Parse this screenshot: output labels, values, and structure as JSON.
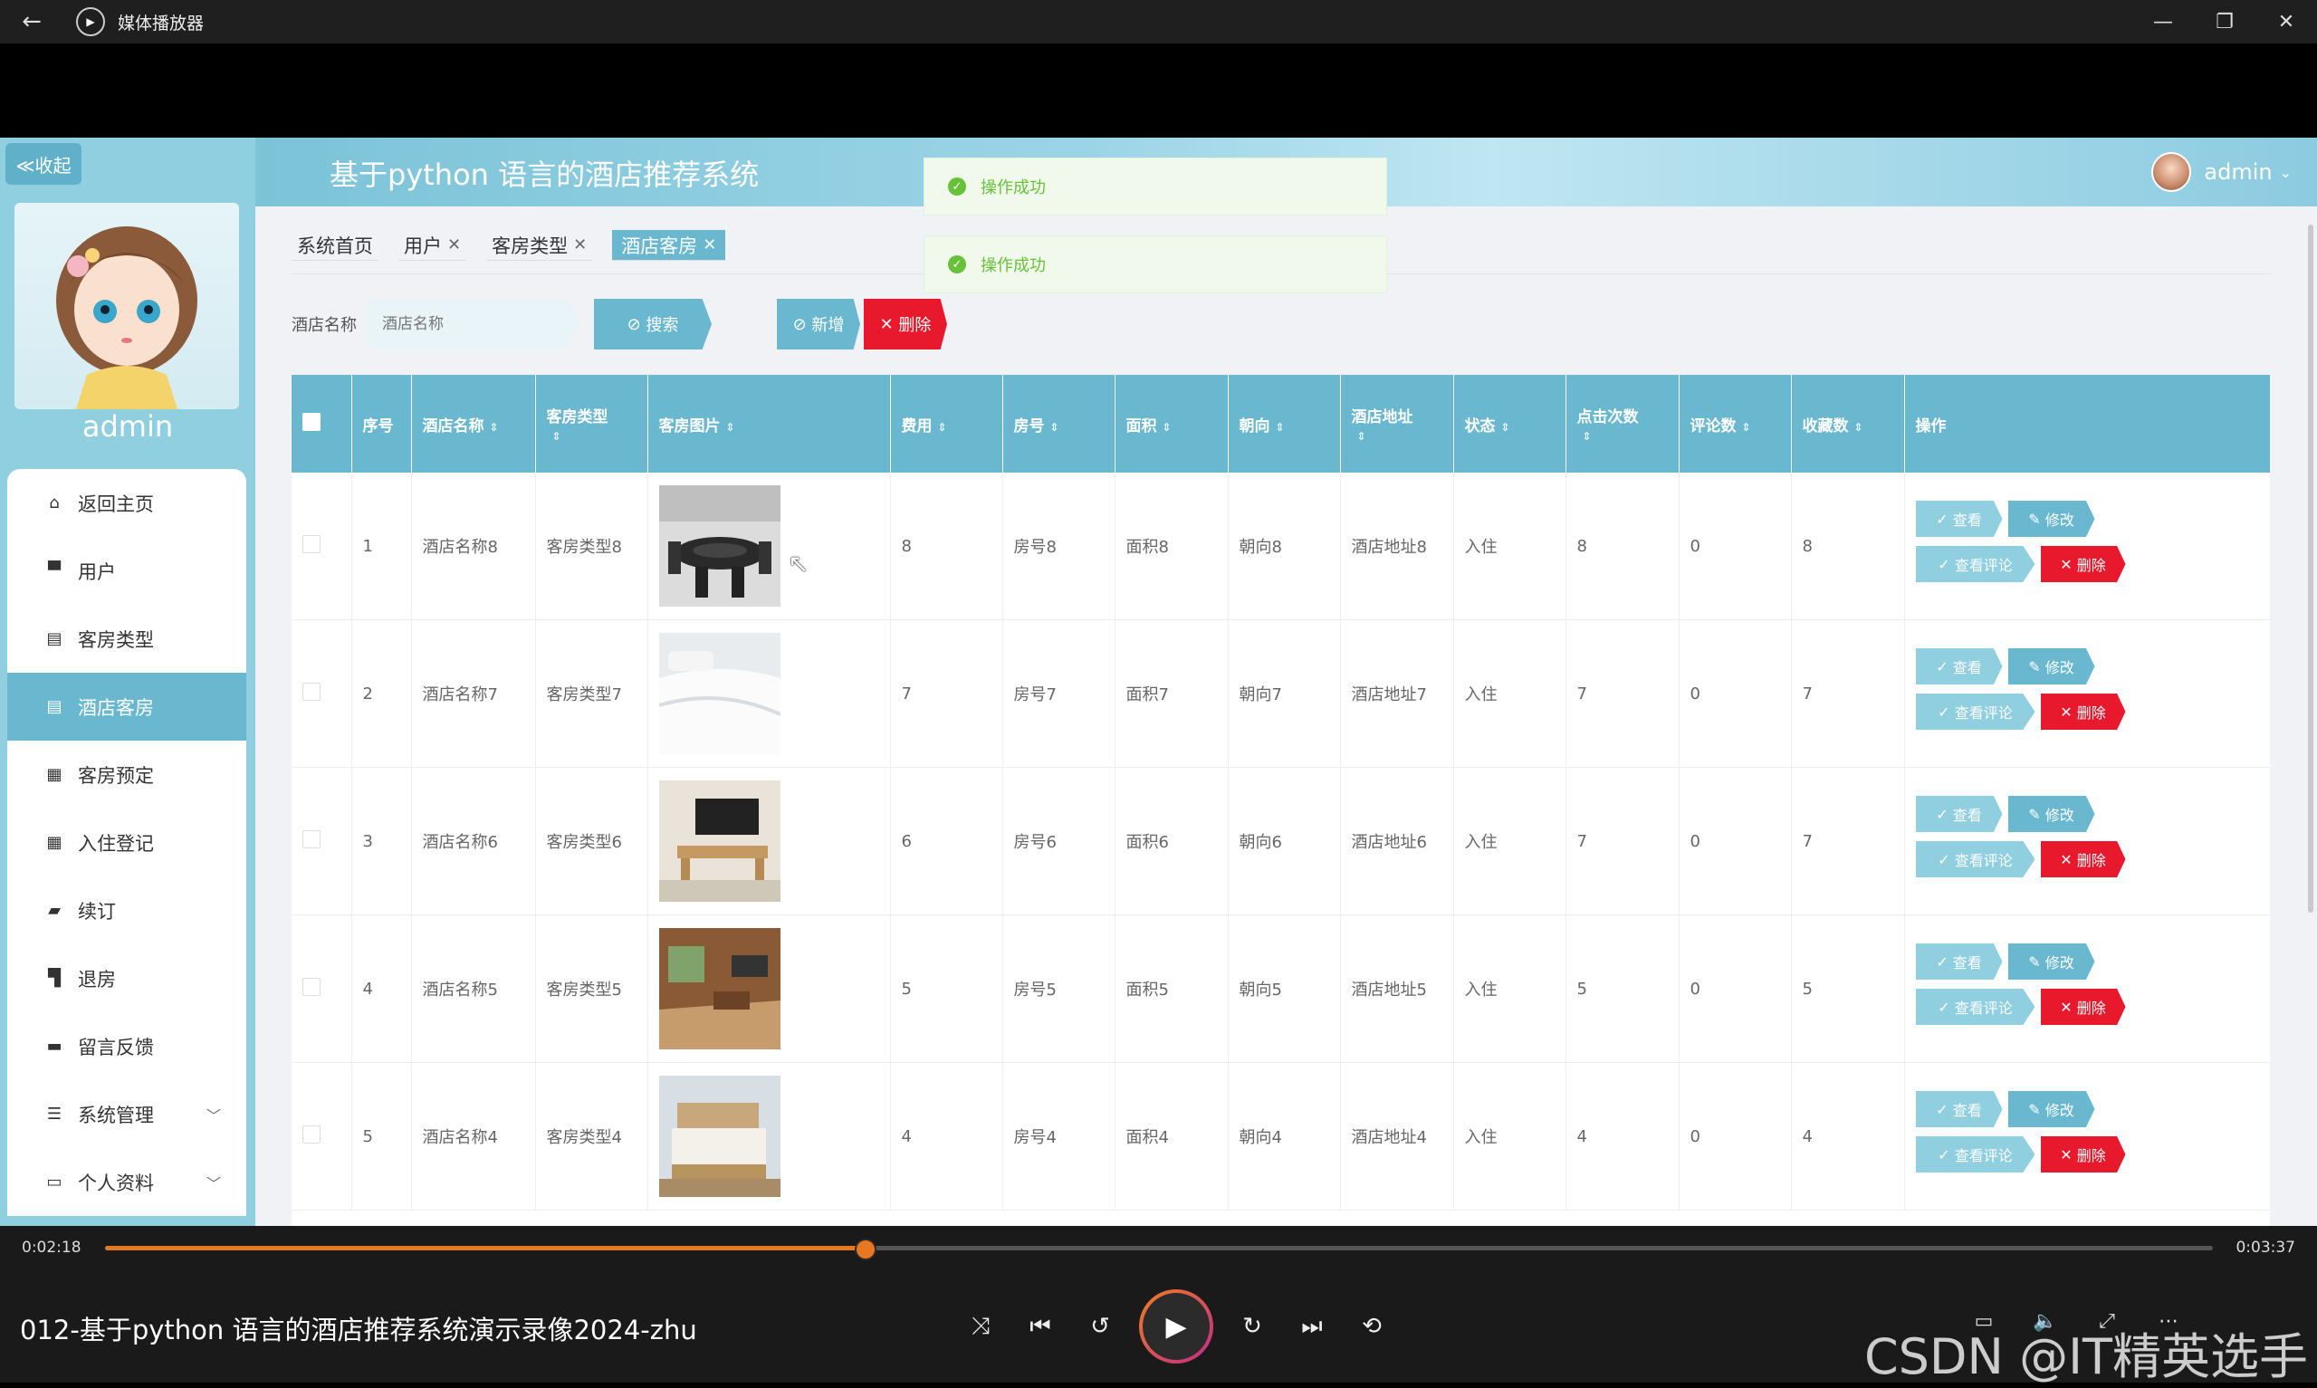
{
  "player": {
    "window_title": "媒体播放器",
    "current_time": "0:02:18",
    "total_time": "0:03:37",
    "progress_fraction": 0.36,
    "media_title": "012-基于python 语言的酒店推荐系统演示录像2024-zhu",
    "watermark": "CSDN @IT精英选手"
  },
  "app": {
    "title": "基于python 语言的酒店推荐系统",
    "collapse_label": "≪收起",
    "user_name": "admin",
    "sidebar_username": "admin",
    "menu": [
      {
        "label": "返回主页",
        "icon": "home-icon"
      },
      {
        "label": "用户",
        "icon": "user-icon"
      },
      {
        "label": "客房类型",
        "icon": "list-icon"
      },
      {
        "label": "酒店客房",
        "icon": "list-icon",
        "active": true
      },
      {
        "label": "客房预定",
        "icon": "grid-icon"
      },
      {
        "label": "入住登记",
        "icon": "grid-icon"
      },
      {
        "label": "续订",
        "icon": "renew-icon"
      },
      {
        "label": "退房",
        "icon": "checkout-icon"
      },
      {
        "label": "留言反馈",
        "icon": "message-icon"
      },
      {
        "label": "系统管理",
        "icon": "settings-icon",
        "expandable": true
      },
      {
        "label": "个人资料",
        "icon": "profile-icon",
        "expandable": true
      }
    ],
    "tabs": [
      {
        "label": "系统首页",
        "closable": false
      },
      {
        "label": "用户",
        "closable": true
      },
      {
        "label": "客房类型",
        "closable": true
      },
      {
        "label": "酒店客房",
        "closable": true,
        "active": true
      }
    ],
    "search": {
      "label": "酒店名称",
      "placeholder": "酒店名称",
      "search_button": "搜索",
      "add_button": "新增",
      "delete_button": "删除"
    },
    "toasts": [
      "操作成功",
      "操作成功"
    ],
    "table": {
      "headers": [
        "序号",
        "酒店名称",
        "客房类型",
        "客房图片",
        "费用",
        "房号",
        "面积",
        "朝向",
        "酒店地址",
        "状态",
        "点击次数",
        "评论数",
        "收藏数",
        "操作"
      ],
      "ops": {
        "view": "查看",
        "edit": "修改",
        "review": "查看评论",
        "delete": "删除"
      },
      "rows": [
        {
          "no": "1",
          "name": "酒店名称8",
          "type": "客房类型8",
          "image": "dining-room",
          "fee": "8",
          "room": "房号8",
          "area": "面积8",
          "facing": "朝向8",
          "address": "酒店地址8",
          "status": "入住",
          "clicks": "8",
          "comments": "0",
          "favorites": "8"
        },
        {
          "no": "2",
          "name": "酒店名称7",
          "type": "客房类型7",
          "image": "white-bed",
          "fee": "7",
          "room": "房号7",
          "area": "面积7",
          "facing": "朝向7",
          "address": "酒店地址7",
          "status": "入住",
          "clicks": "7",
          "comments": "0",
          "favorites": "7"
        },
        {
          "no": "3",
          "name": "酒店名称6",
          "type": "客房类型6",
          "image": "tv-desk",
          "fee": "6",
          "room": "房号6",
          "area": "面积6",
          "facing": "朝向6",
          "address": "酒店地址6",
          "status": "入住",
          "clicks": "7",
          "comments": "0",
          "favorites": "7"
        },
        {
          "no": "4",
          "name": "酒店名称5",
          "type": "客房类型5",
          "image": "wood-room",
          "fee": "5",
          "room": "房号5",
          "area": "面积5",
          "facing": "朝向5",
          "address": "酒店地址5",
          "status": "入住",
          "clicks": "5",
          "comments": "0",
          "favorites": "5"
        },
        {
          "no": "5",
          "name": "酒店名称4",
          "type": "客房类型4",
          "image": "bedroom",
          "fee": "4",
          "room": "房号4",
          "area": "面积4",
          "facing": "朝向4",
          "address": "酒店地址4",
          "status": "入住",
          "clicks": "4",
          "comments": "0",
          "favorites": "4"
        }
      ]
    }
  }
}
